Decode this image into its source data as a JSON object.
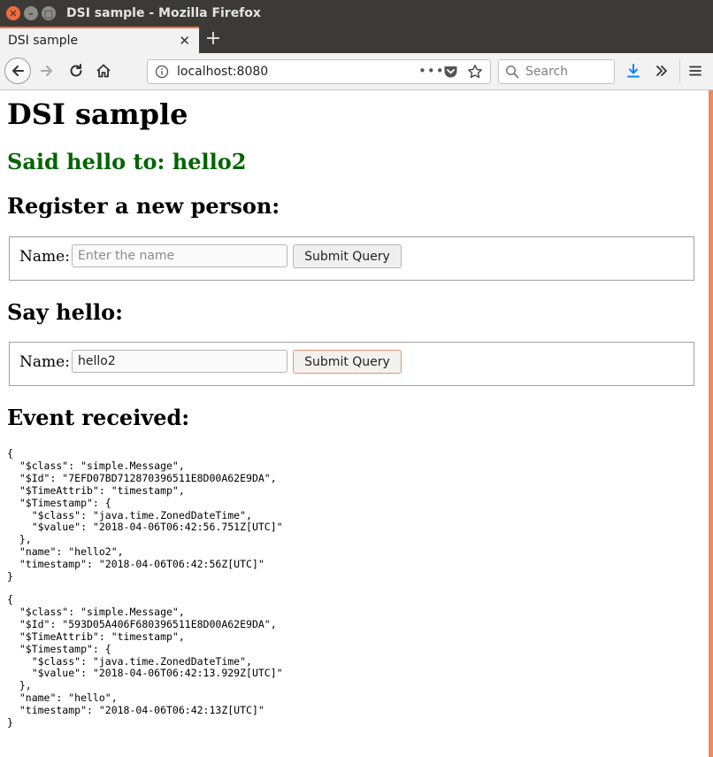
{
  "window": {
    "title": "DSI sample - Mozilla Firefox"
  },
  "tabs": [
    {
      "label": "DSI sample",
      "active": true
    }
  ],
  "toolbar": {
    "url": "localhost:8080",
    "search_placeholder": "Search",
    "page_actions_label": "•••"
  },
  "page": {
    "title": "DSI sample",
    "greeting": "Said hello to: hello2",
    "register": {
      "heading": "Register a new person:",
      "label": "Name:",
      "placeholder": "Enter the name",
      "value": "",
      "submit_label": "Submit Query"
    },
    "say_hello": {
      "heading": "Say hello:",
      "label": "Name:",
      "value": "hello2",
      "submit_label": "Submit Query"
    },
    "events_heading": "Event received:",
    "events": [
      "{\n  \"$class\": \"simple.Message\",\n  \"$Id\": \"7EFD07BD712870396511E8D00A62E9DA\",\n  \"$TimeAttrib\": \"timestamp\",\n  \"$Timestamp\": {\n    \"$class\": \"java.time.ZonedDateTime\",\n    \"$value\": \"2018-04-06T06:42:56.751Z[UTC]\"\n  },\n  \"name\": \"hello2\",\n  \"timestamp\": \"2018-04-06T06:42:56Z[UTC]\"\n}",
      "{\n  \"$class\": \"simple.Message\",\n  \"$Id\": \"593D05A406F680396511E8D00A62E9DA\",\n  \"$TimeAttrib\": \"timestamp\",\n  \"$Timestamp\": {\n    \"$class\": \"java.time.ZonedDateTime\",\n    \"$value\": \"2018-04-06T06:42:13.929Z[UTC]\"\n  },\n  \"name\": \"hello\",\n  \"timestamp\": \"2018-04-06T06:42:13Z[UTC]\"\n}"
    ]
  },
  "colors": {
    "accent": "#ef6b3b",
    "greeting": "#006400",
    "titlebar": "#3b3a36",
    "download_icon": "#0a84ff"
  },
  "icons": [
    "close-icon",
    "minimize-icon",
    "maximize-icon",
    "tab-close-icon",
    "new-tab-icon",
    "back-icon",
    "forward-icon",
    "reload-icon",
    "home-icon",
    "info-icon",
    "page-actions-icon",
    "pocket-icon",
    "bookmark-star-icon",
    "search-icon",
    "download-icon",
    "overflow-icon",
    "menu-icon"
  ]
}
